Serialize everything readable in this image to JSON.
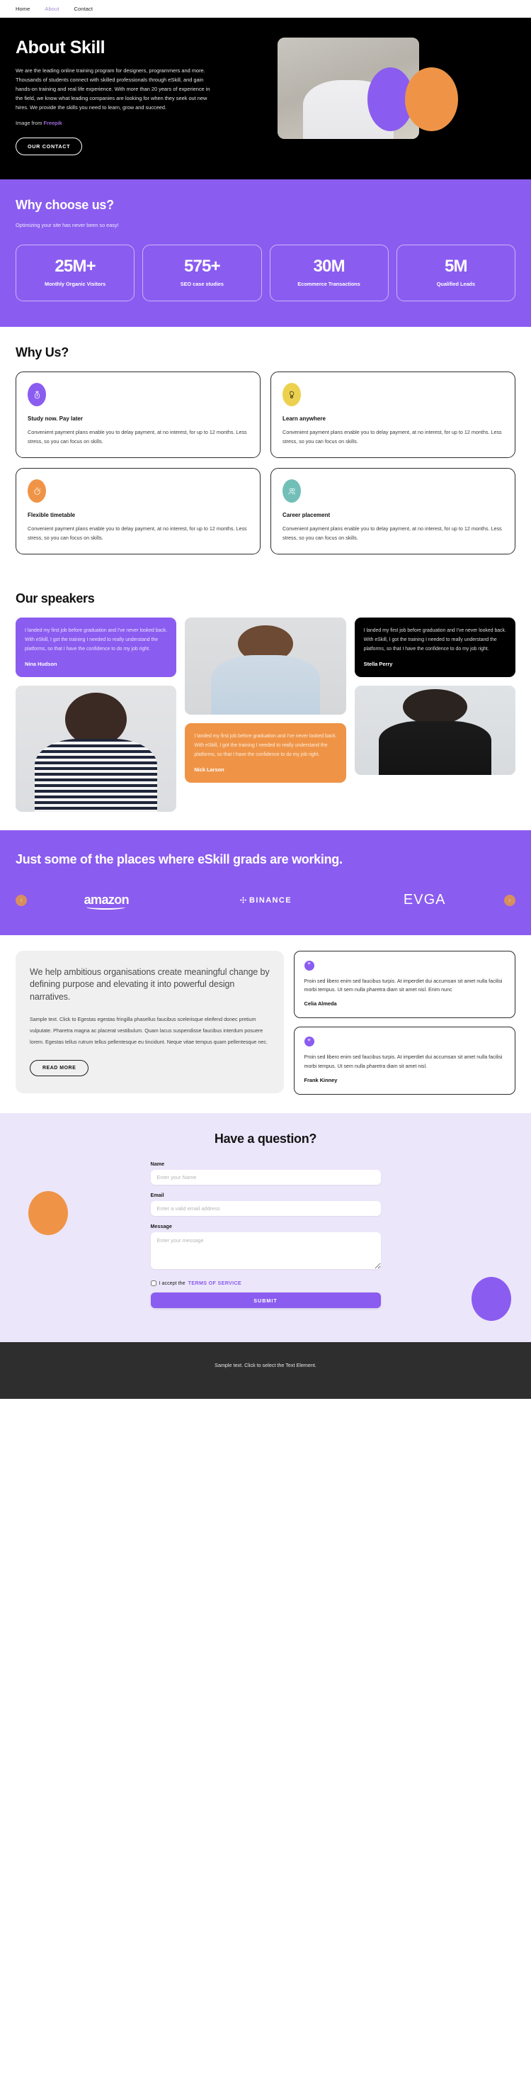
{
  "nav": {
    "items": [
      {
        "label": "Home",
        "active": false
      },
      {
        "label": "About",
        "active": true
      },
      {
        "label": "Contact",
        "active": false
      }
    ]
  },
  "hero": {
    "title": "About Skill",
    "paragraph": "We are the leading online training program for designers, programmers and more. Thousands of students connect with skilled professionals through eSkill, and gain hands-on training and real life experience. With more than 20 years of experience in the field, we know what leading companies are looking for when they seek out new hires. We provide the skills you need to learn, grow and succeed.",
    "credit_prefix": "Image from ",
    "credit_link": "Freepik",
    "cta_label": "OUR CONTACT",
    "image_alt": "Woman wearing a VR headset raising her hand"
  },
  "stats": {
    "title": "Why choose us?",
    "subtitle": "Optimizing your site has never been so easy!",
    "cards": [
      {
        "value": "25M+",
        "label": "Monthly Organic Visitors"
      },
      {
        "value": "575+",
        "label": "SEO case studies"
      },
      {
        "value": "30M",
        "label": "Ecommerce Transactions"
      },
      {
        "value": "5M",
        "label": "Qualified Leads"
      }
    ]
  },
  "whyus": {
    "title": "Why Us?",
    "cards": [
      {
        "icon": "money-bag-icon",
        "icon_color": "#8b5cf0",
        "title": "Study now. Pay later",
        "text": "Convenient payment plans enable you to delay payment, at no interest, for up to 12 months. Less stress, so you can focus on skills."
      },
      {
        "icon": "hand-coin-icon",
        "icon_color": "#ecd14f",
        "title": "Learn anywhere",
        "text": "Convenient payment plans enable you to delay payment, at no interest, for up to 12 months. Less stress, so you can focus on skills."
      },
      {
        "icon": "stopwatch-icon",
        "icon_color": "#ef9447",
        "title": "Flexible timetable",
        "text": "Convenient payment plans enable you to delay payment, at no interest, for up to 12 months. Less stress, so you can focus on skills."
      },
      {
        "icon": "people-icon",
        "icon_color": "#72bfb8",
        "title": "Career placement",
        "text": "Convenient payment plans enable you to delay payment, at no interest, for up to 12 months. Less stress, so you can focus on skills."
      }
    ]
  },
  "speakers": {
    "title": "Our speakers",
    "quote_text": "I landed my first job before graduation and I've never looked back. With eSkill, I got the training I needed to really understand the platforms, so that I have the confidence to do my job right.",
    "testimonials": [
      {
        "name": "Nina Hudson",
        "theme": "purple"
      },
      {
        "name": "Stella Perry",
        "theme": "black"
      },
      {
        "name": "Nick Larson",
        "theme": "orange"
      }
    ],
    "photos": [
      {
        "alt": "Smiling woman with long dark hair in a striped shirt"
      },
      {
        "alt": "Smiling man with curly hair in a light blue shirt"
      },
      {
        "alt": "Woman with short dark hair in a black dress, arms crossed"
      }
    ]
  },
  "logos": {
    "title": "Just some of the places where eSkill grads are working.",
    "prev_label": "‹",
    "next_label": "›",
    "brands": [
      {
        "name": "amazon"
      },
      {
        "name": "BINANCE"
      },
      {
        "name": "EVGA"
      }
    ]
  },
  "org": {
    "heading": "We help ambitious organisations create meaningful change by defining purpose and elevating it into powerful design narratives.",
    "body": "Sample text. Click to Egestas egestas fringilla phasellus faucibus scelerisque eleifend donec pretium vulputate. Pharetra magna ac placerat vestibulum. Quam lacus suspendisse faucibus interdum posuere lorem. Egestas tellus rutrum tellus pellentesque eu tincidunt. Neque vitae tempus quam pellentesque nec.",
    "read_more_label": "READ MORE",
    "testimonials": [
      {
        "badge": "”",
        "text": "Proin sed libero enim sed faucibus turpis. At imperdiet dui accumsan sit amet nulla facilisi morbi tempus. Ut sem nulla pharetra diam sit amet nisl. Enim nunc",
        "name": "Celia Almeda"
      },
      {
        "badge": "”",
        "text": "Proin sed libero enim sed faucibus turpis. At imperdiet dui accumsan sit amet nulla facilisi morbi tempus. Ut sem nulla pharetra diam sit amet nisl.",
        "name": "Frank Kinney"
      }
    ]
  },
  "form": {
    "title": "Have a question?",
    "name_label": "Name",
    "name_placeholder": "Enter your Name",
    "email_label": "Email",
    "email_placeholder": "Enter a valid email address",
    "message_label": "Message",
    "message_placeholder": "Enter your message",
    "accept_prefix": "I accept the ",
    "terms_label": "TERMS OF SERVICE",
    "submit_label": "SUBMIT"
  },
  "footer": {
    "text": "Sample text. Click to select the Text Element."
  },
  "theme": {
    "purple": "#8b5cf0",
    "orange": "#ef9447",
    "yellow": "#ecd14f",
    "teal": "#72bfb8",
    "black": "#000000",
    "form_bg": "#ece6fa",
    "footer_bg": "#2e2e2e"
  }
}
